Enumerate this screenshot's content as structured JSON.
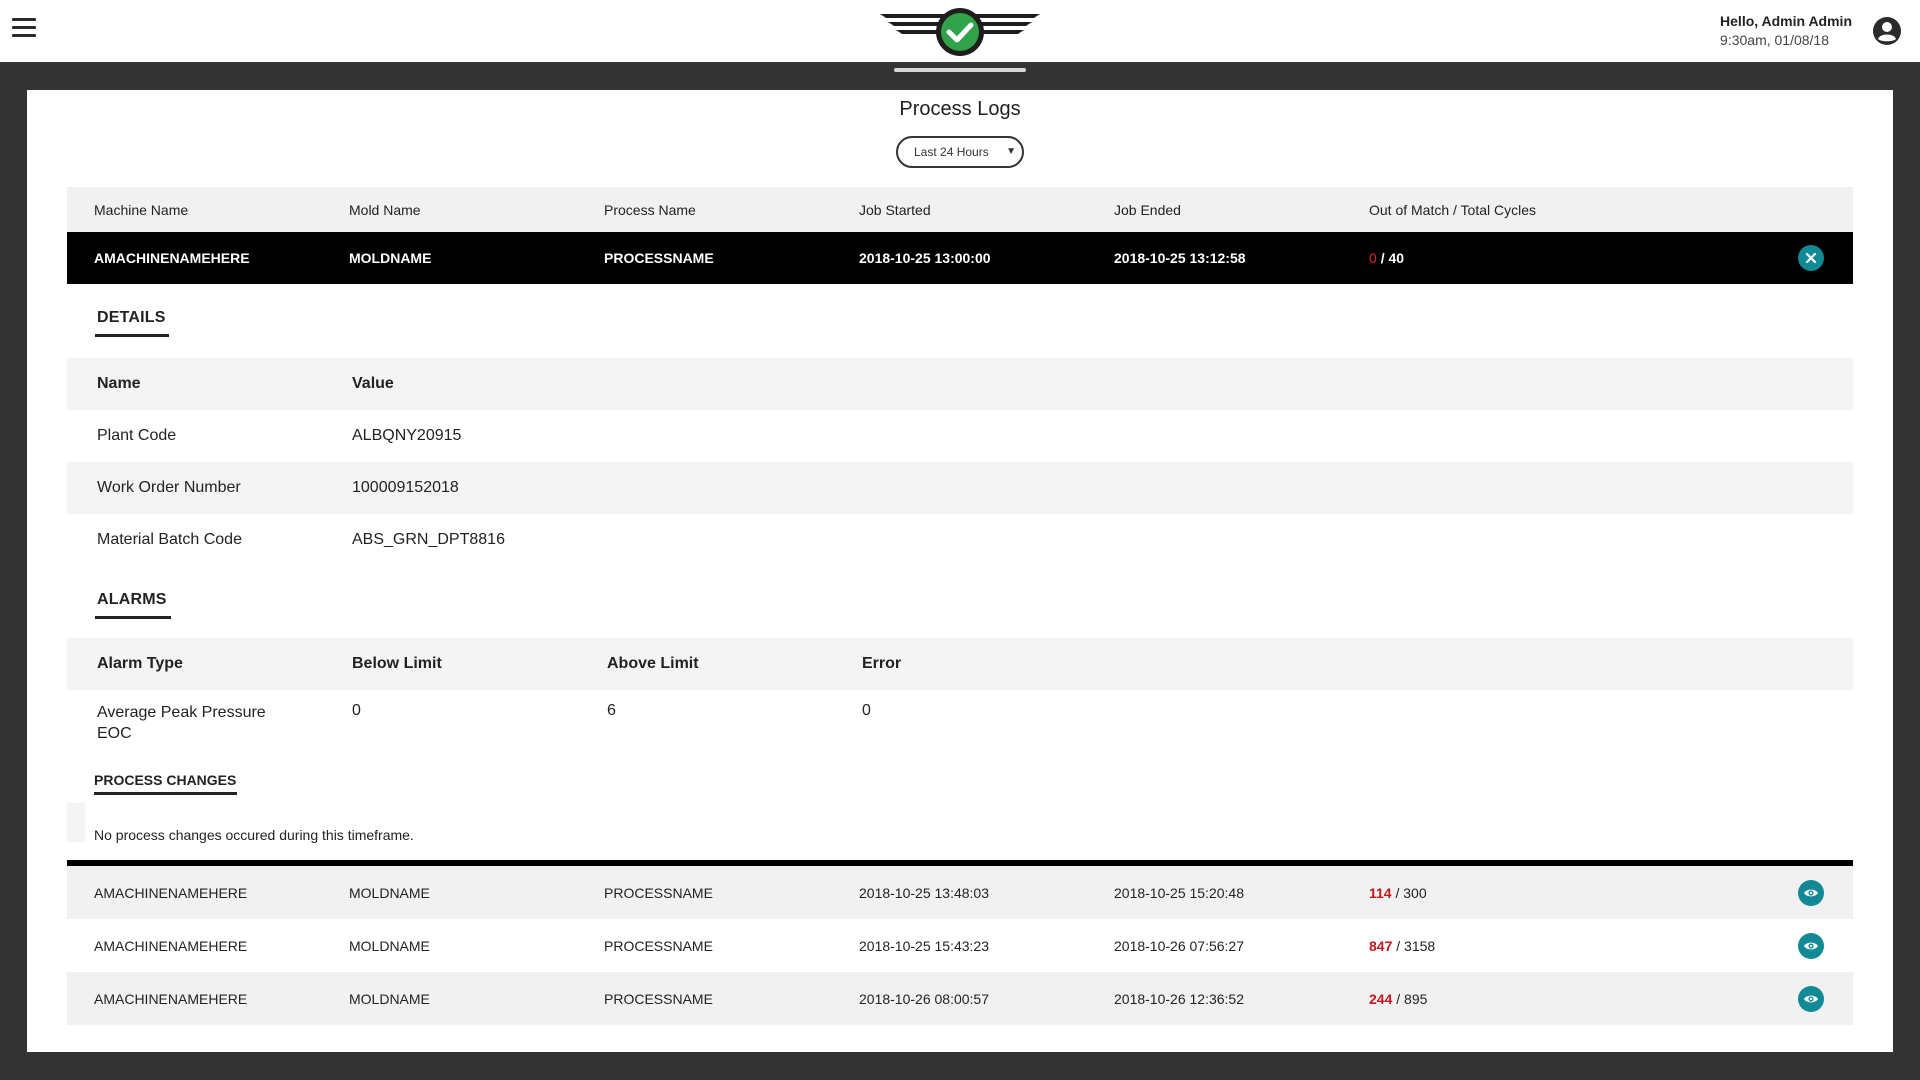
{
  "header": {
    "greeting": "Hello, Admin Admin",
    "datetime": "9:30am, 01/08/18",
    "logo_status_color": "#2fa24a"
  },
  "page": {
    "title": "Process Logs",
    "range_value": "Last 24 Hours"
  },
  "table": {
    "columns": [
      "Machine Name",
      "Mold Name",
      "Process Name",
      "Job Started",
      "Job Ended",
      "Out of Match / Total Cycles"
    ],
    "selected": {
      "machine": "AMACHINENAMEHERE",
      "mold": "MOLDNAME",
      "process": "PROCESSNAME",
      "started": "2018-10-25 13:00:00",
      "ended": "2018-10-25 13:12:58",
      "out_of_match": "0",
      "total_cycles": "/ 40"
    },
    "rows": [
      {
        "machine": "AMACHINENAMEHERE",
        "mold": "MOLDNAME",
        "process": "PROCESSNAME",
        "started": "2018-10-25 13:48:03",
        "ended": "2018-10-25 15:20:48",
        "out_of_match": "114",
        "total_cycles": "/ 300"
      },
      {
        "machine": "AMACHINENAMEHERE",
        "mold": "MOLDNAME",
        "process": "PROCESSNAME",
        "started": "2018-10-25 15:43:23",
        "ended": "2018-10-26 07:56:27",
        "out_of_match": "847",
        "total_cycles": "/ 3158"
      },
      {
        "machine": "AMACHINENAMEHERE",
        "mold": "MOLDNAME",
        "process": "PROCESSNAME",
        "started": "2018-10-26 08:00:57",
        "ended": "2018-10-26 12:36:52",
        "out_of_match": "244",
        "total_cycles": "/ 895"
      }
    ]
  },
  "details": {
    "tab_label": "DETAILS",
    "columns": [
      "Name",
      "Value"
    ],
    "items": [
      {
        "name": "Plant Code",
        "value": "ALBQNY20915"
      },
      {
        "name": "Work Order Number",
        "value": "100009152018"
      },
      {
        "name": "Material Batch Code",
        "value": "ABS_GRN_DPT8816"
      }
    ]
  },
  "alarms": {
    "tab_label": "ALARMS",
    "columns": [
      "Alarm Type",
      "Below Limit",
      "Above Limit",
      "Error"
    ],
    "items": [
      {
        "type_line1": "Average Peak Pressure",
        "type_line2": "EOC",
        "below": "0",
        "above": "6",
        "error": "0"
      }
    ]
  },
  "process_changes": {
    "tab_label": "PROCESS CHANGES",
    "message": "No process changes occured during this timeframe."
  },
  "colors": {
    "accent": "#128a96",
    "alert": "#c0171d",
    "background": "#333333"
  },
  "icons": {
    "menu": "hamburger-menu-icon",
    "user": "user-account-icon",
    "close": "close-icon",
    "view": "eye-icon"
  }
}
